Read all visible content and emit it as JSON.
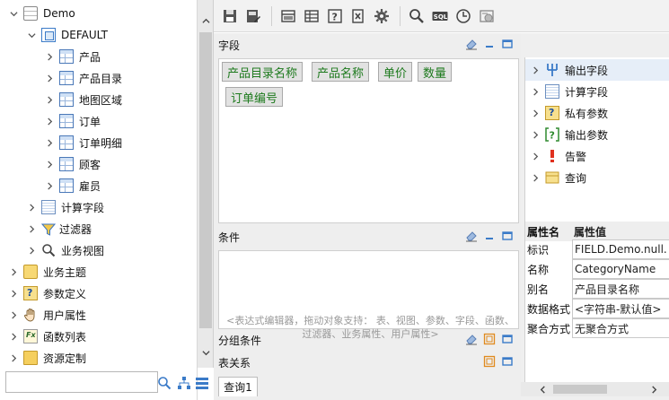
{
  "tree": {
    "root": "Demo",
    "schema": "DEFAULT",
    "tables": [
      "产品",
      "产品目录",
      "地图区域",
      "订单",
      "订单明细",
      "顾客",
      "雇员"
    ],
    "schema_children": [
      "计算字段",
      "过滤器",
      "业务视图"
    ],
    "top_items": [
      "业务主题",
      "参数定义",
      "用户属性",
      "函数列表",
      "资源定制"
    ]
  },
  "search": {
    "value": "",
    "placeholder": ""
  },
  "toolbar": {
    "icons": [
      "save-icon",
      "save-as-icon",
      "layout-icon",
      "table-icon",
      "param-icon",
      "export-icon",
      "gear-icon",
      "search-icon",
      "sql-icon",
      "clock-icon",
      "cache-icon"
    ],
    "sql_text": "SQL"
  },
  "sections": {
    "fields_title": "字段",
    "condition_title": "条件",
    "group_title": "分组条件",
    "relation_title": "表关系"
  },
  "fields": [
    "产品目录名称",
    "产品名称",
    "单价",
    "数量",
    "订单编号"
  ],
  "condition_hint": "<表达式编辑器，拖动对象支持： 表、视图、参数、字段、函数、过滤器、业务属性、用户属性>",
  "query_tab": "查询1",
  "output_tree": [
    "输出字段",
    "计算字段",
    "私有参数",
    "输出参数",
    "告警",
    "查询"
  ],
  "props": {
    "header_name": "属性名",
    "header_value": "属性值",
    "rows": [
      {
        "name": "标识",
        "value": "FIELD.Demo.null."
      },
      {
        "name": "名称",
        "value": "CategoryName"
      },
      {
        "name": "别名",
        "value": "产品目录名称"
      },
      {
        "name": "数据格式",
        "value": "<字符串-默认值>"
      },
      {
        "name": "聚合方式",
        "value": "无聚合方式"
      }
    ]
  },
  "colors": {
    "field_text": "#1d7a1d",
    "accent_blue": "#3b7bc8",
    "panel_bg": "#eeeeee"
  }
}
